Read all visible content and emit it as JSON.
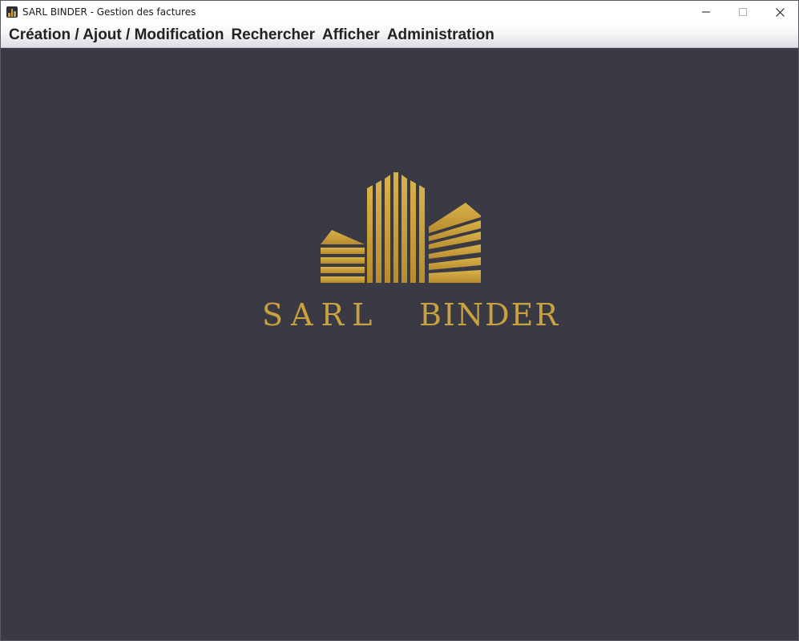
{
  "window": {
    "title": "SARL BINDER - Gestion des factures"
  },
  "menubar": {
    "items": [
      {
        "label": "Création / Ajout / Modification"
      },
      {
        "label": "Rechercher"
      },
      {
        "label": "Afficher"
      },
      {
        "label": "Administration"
      }
    ]
  },
  "logo": {
    "word1": "SARL",
    "word2": "BINDER"
  },
  "colors": {
    "background": "#3a3a44",
    "gold": "#c9a13e"
  }
}
